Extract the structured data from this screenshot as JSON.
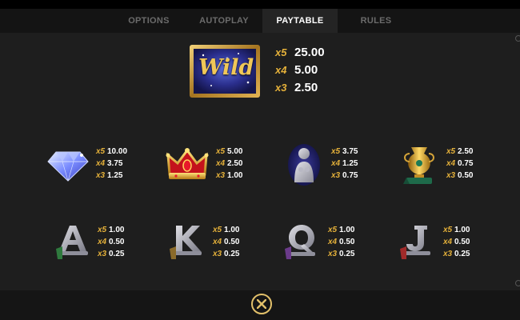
{
  "tabs": [
    {
      "label": "OPTIONS",
      "active": false
    },
    {
      "label": "AUTOPLAY",
      "active": false
    },
    {
      "label": "PAYTABLE",
      "active": true
    },
    {
      "label": "RULES",
      "active": false
    }
  ],
  "wild": {
    "label": "Wild",
    "icon": "wild-symbol-icon",
    "pays": [
      {
        "mult": "x5",
        "value": "25.00"
      },
      {
        "mult": "x4",
        "value": "5.00"
      },
      {
        "mult": "x3",
        "value": "2.50"
      }
    ]
  },
  "symbols": [
    {
      "icon": "diamond-icon",
      "pays": [
        {
          "mult": "x5",
          "value": "10.00"
        },
        {
          "mult": "x4",
          "value": "3.75"
        },
        {
          "mult": "x3",
          "value": "1.25"
        }
      ]
    },
    {
      "icon": "crown-icon",
      "pays": [
        {
          "mult": "x5",
          "value": "5.00"
        },
        {
          "mult": "x4",
          "value": "2.50"
        },
        {
          "mult": "x3",
          "value": "1.00"
        }
      ]
    },
    {
      "icon": "statue-icon",
      "pays": [
        {
          "mult": "x5",
          "value": "3.75"
        },
        {
          "mult": "x4",
          "value": "1.25"
        },
        {
          "mult": "x3",
          "value": "0.75"
        }
      ]
    },
    {
      "icon": "golden-vase-icon",
      "pays": [
        {
          "mult": "x5",
          "value": "2.50"
        },
        {
          "mult": "x4",
          "value": "0.75"
        },
        {
          "mult": "x3",
          "value": "0.50"
        }
      ]
    },
    {
      "icon": "letter-a-icon",
      "letter": "A",
      "pays": [
        {
          "mult": "x5",
          "value": "1.00"
        },
        {
          "mult": "x4",
          "value": "0.50"
        },
        {
          "mult": "x3",
          "value": "0.25"
        }
      ]
    },
    {
      "icon": "letter-k-icon",
      "letter": "K",
      "pays": [
        {
          "mult": "x5",
          "value": "1.00"
        },
        {
          "mult": "x4",
          "value": "0.50"
        },
        {
          "mult": "x3",
          "value": "0.25"
        }
      ]
    },
    {
      "icon": "letter-q-icon",
      "letter": "Q",
      "pays": [
        {
          "mult": "x5",
          "value": "1.00"
        },
        {
          "mult": "x4",
          "value": "0.50"
        },
        {
          "mult": "x3",
          "value": "0.25"
        }
      ]
    },
    {
      "icon": "letter-j-icon",
      "letter": "J",
      "pays": [
        {
          "mult": "x5",
          "value": "1.00"
        },
        {
          "mult": "x4",
          "value": "0.50"
        },
        {
          "mult": "x3",
          "value": "0.25"
        }
      ]
    }
  ],
  "close_icon": "close-icon",
  "colors": {
    "multiplier": "#e5b13a",
    "value": "#ffffff",
    "tab_active_bg": "#242424",
    "tab_inactive_text": "#6b6b6b",
    "panel_bg": "#1e1e1e",
    "close_ring": "#e2c06a"
  }
}
